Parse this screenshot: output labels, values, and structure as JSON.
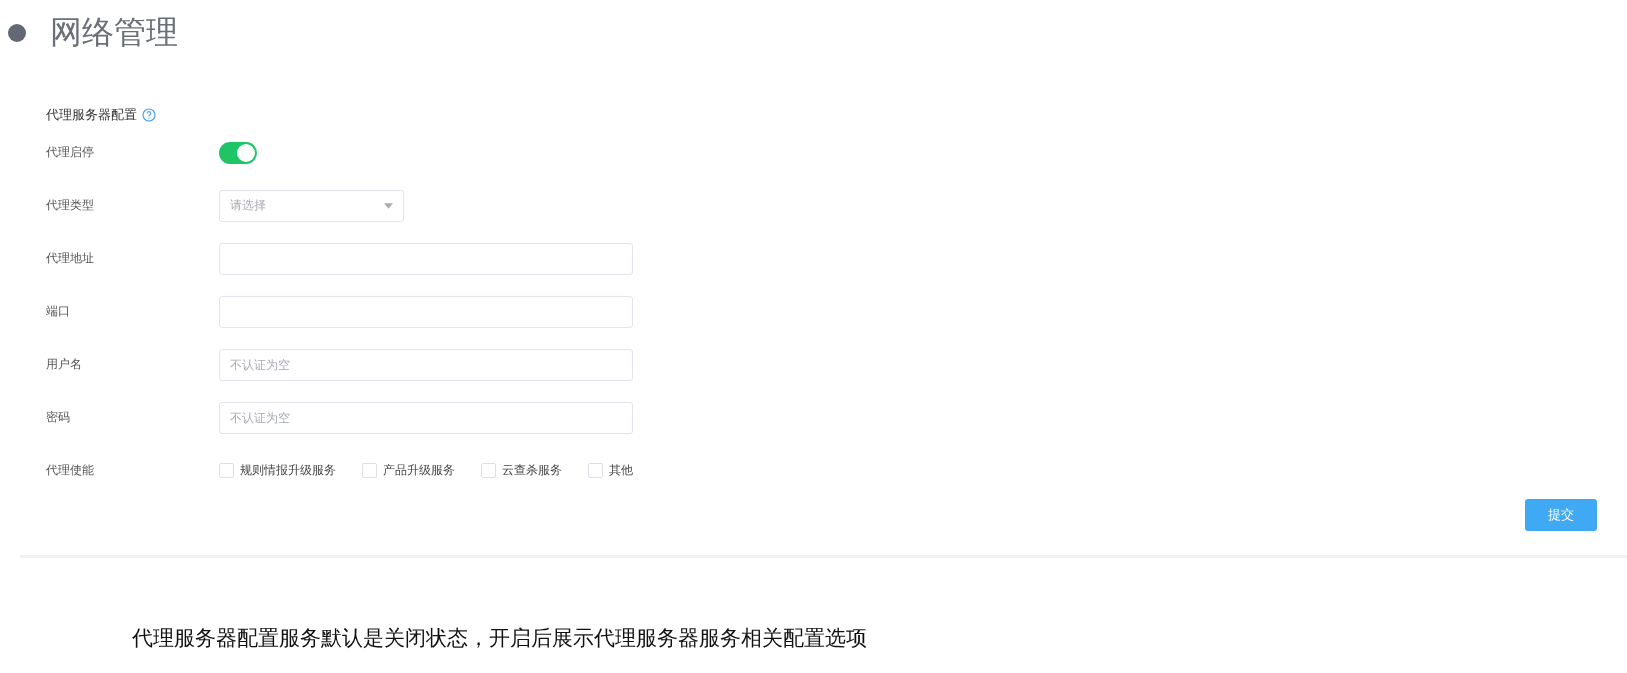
{
  "heading": "网络管理",
  "section": {
    "title": "代理服务器配置"
  },
  "rows": [
    {
      "kind": "switch",
      "label": "代理启停",
      "on": true
    },
    {
      "kind": "select",
      "label": "代理类型",
      "placeholder": "请选择"
    },
    {
      "kind": "input",
      "label": "代理地址"
    },
    {
      "kind": "input",
      "label": "端口"
    },
    {
      "kind": "input",
      "label": "用户名",
      "placeholder": "不认证为空"
    },
    {
      "kind": "input",
      "label": "密码",
      "placeholder": "不认证为空"
    },
    {
      "kind": "checkboxes",
      "label": "代理使能",
      "options": [
        {
          "label": "规则情报升级服务",
          "checked": false
        },
        {
          "label": "产品升级服务",
          "checked": false
        },
        {
          "label": "云查杀服务",
          "checked": false
        },
        {
          "label": "其他",
          "checked": false
        }
      ]
    }
  ],
  "submit": "提交",
  "caption": "代理服务器配置服务默认是关闭状态，开启后展示代理服务器服务相关配置选项"
}
